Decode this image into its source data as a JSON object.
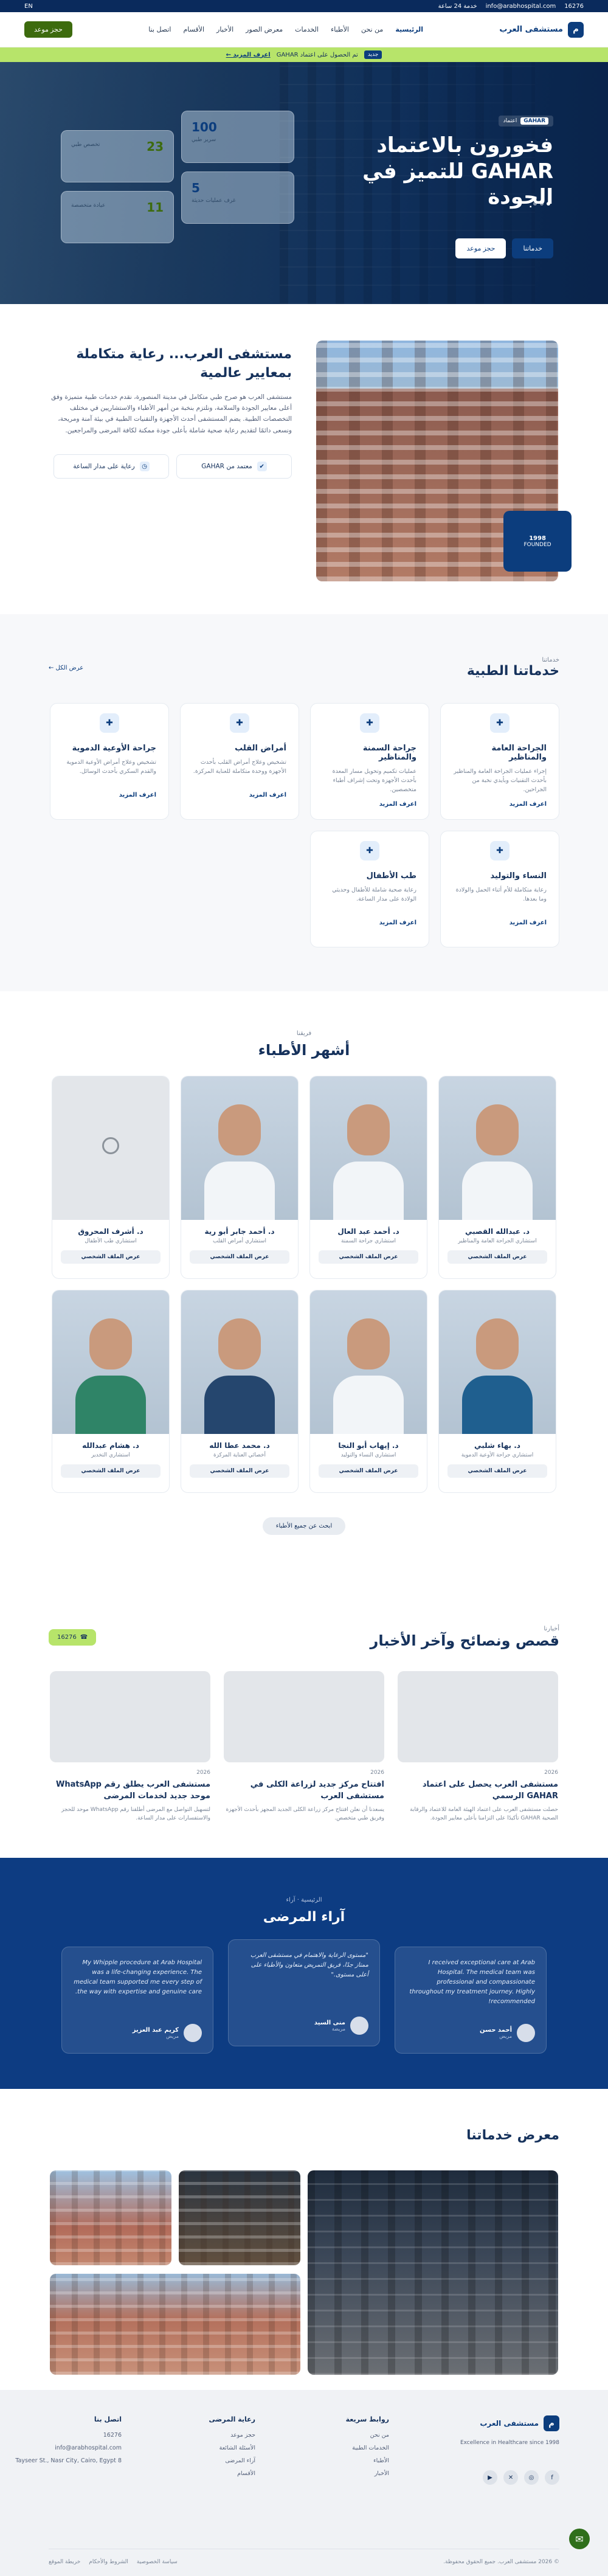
{
  "topbar": {
    "phone": "16276",
    "email": "info@arabhospital.com",
    "hours": "خدمة 24 ساعة",
    "lang": "EN"
  },
  "header": {
    "logo": "م",
    "brand": "مستشفى العرب",
    "nav": [
      "الرئيسية",
      "من نحن",
      "الأطباء",
      "الخدمات",
      "معرض الصور",
      "الأخبار",
      "الأقسام",
      "اتصل بنا"
    ],
    "book": "حجز موعد"
  },
  "announce": {
    "tag": "جديد",
    "text": "تم الحصول على اعتماد GAHAR",
    "link": "اعرف المزيد ←"
  },
  "hero": {
    "badge_tag": "GAHAR",
    "badge_text": "اعتماد",
    "title": "فخورون بالاعتماد GAHAR للتميز في الجودة",
    "primary": "خدماتنا",
    "secondary": "حجز موعد",
    "stats": [
      {
        "value": "100",
        "label": "سرير طبي",
        "green": false
      },
      {
        "value": "23",
        "label": "تخصص طبي",
        "green": true
      },
      {
        "value": "5",
        "label": "غرف عمليات حديثة",
        "green": false
      },
      {
        "value": "11",
        "label": "عيادة متخصصة",
        "green": true
      }
    ]
  },
  "about": {
    "tag_title": "1998",
    "tag_sub": "FOUNDED",
    "title": "مستشفى العرب... رعاية متكاملة بمعايير عالمية",
    "body": "مستشفى العرب هو صرح طبي متكامل في مدينة المنصورة، نقدم خدمات طبية متميزة وفق أعلى معايير الجودة والسلامة، ونلتزم بنخبة من أمهر الأطباء والاستشاريين في مختلف التخصصات الطبية. يضم المستشفى أحدث الأجهزة والتقنيات الطبية في بيئة آمنة ومريحة، ونسعى دائمًا لتقديم رعاية صحية شاملة بأعلى جودة ممكنة لكافة المرضى والمراجعين.",
    "pill1": "معتمد من GAHAR",
    "pill2": "رعاية على مدار الساعة"
  },
  "services": {
    "sub": "خدماتنا",
    "title": "خدماتنا الطبية",
    "link": "عرض الكل ←",
    "more": "اعرف المزيد",
    "items": [
      {
        "title": "الجراحة العامة والمناظير",
        "desc": "إجراء عمليات الجراحة العامة والمناظير بأحدث التقنيات وبأيدي نخبة من الجراحين."
      },
      {
        "title": "جراحة السمنة والمناظير",
        "desc": "عمليات تكميم وتحويل مسار المعدة بأحدث الأجهزة وتحت إشراف أطباء متخصصين."
      },
      {
        "title": "أمراض القلب",
        "desc": "تشخيص وعلاج أمراض القلب بأحدث الأجهزة ووحدة متكاملة للعناية المركزة."
      },
      {
        "title": "جراحة الأوعية الدموية",
        "desc": "تشخيص وعلاج أمراض الأوعية الدموية والقدم السكري بأحدث الوسائل."
      },
      {
        "title": "النساء والتوليد",
        "desc": "رعاية متكاملة للأم أثناء الحمل والولادة وما بعدها."
      },
      {
        "title": "طب الأطفال",
        "desc": "رعاية صحية شاملة للأطفال وحديثي الولادة على مدار الساعة."
      }
    ]
  },
  "doctors": {
    "kicker": "فريقنا",
    "title": "أشهر الأطباء",
    "profile": "عرض الملف الشخصي",
    "all": "ابحث عن جميع الأطباء",
    "items": [
      {
        "name": "د. عبدالله القصبي",
        "spec": "استشاري الجراحة العامة والمناظير",
        "style": "coat"
      },
      {
        "name": "د. أحمد عبد العال",
        "spec": "استشاري جراحة السمنة",
        "style": "coat"
      },
      {
        "name": "د. أحمد جابر أبو رية",
        "spec": "استشاري أمراض القلب",
        "style": "coat"
      },
      {
        "name": "د. أشرف المحروق",
        "spec": "استشاري طب الأطفال",
        "style": "empty"
      },
      {
        "name": "د. بهاء شلبي",
        "spec": "استشاري جراحة الأوعية الدموية",
        "style": "scrubs"
      },
      {
        "name": "د. إيهاب أبو النجا",
        "spec": "استشاري النساء والتوليد",
        "style": "coat"
      },
      {
        "name": "د. محمد عطا الله",
        "spec": "أخصائي العناية المركزة",
        "style": "navy"
      },
      {
        "name": "د. هشام عبدالله",
        "spec": "استشاري التخدير",
        "style": "green"
      }
    ]
  },
  "news": {
    "sub": "أخبارنا",
    "title": "قصص ونصائح وآخر الأخبار",
    "chip": "16276",
    "items": [
      {
        "date": "2026",
        "title": "مستشفى العرب يحصل على اعتماد GAHAR الرسمي",
        "excerpt": "حصلت مستشفى العرب على اعتماد الهيئة العامة للاعتماد والرقابة الصحية GAHAR تأكيدًا على التزامنا بأعلى معايير الجودة."
      },
      {
        "date": "2026",
        "title": "افتتاح مركز جديد لزراعة الكلى في مستشفى العرب",
        "excerpt": "يسعدنا أن نعلن افتتاح مركز زراعة الكلى الجديد المجهز بأحدث الأجهزة وفريق طبي متخصص."
      },
      {
        "date": "2026",
        "title": "مستشفى العرب يطلق رقم WhatsApp موحد جديد لخدمات المرضى",
        "excerpt": "لتسهيل التواصل مع المرضى أطلقنا رقم WhatsApp موحد للحجز والاستفسارات على مدار الساعة."
      }
    ]
  },
  "testimonials": {
    "crumb": "الرئيسية · آراء",
    "title": "آراء المرضى",
    "items": [
      {
        "quote": "I received exceptional care at Arab Hospital. The medical team was professional and compassionate throughout my treatment journey. Highly recommended!",
        "name": "أحمد حسن",
        "role": "مريض"
      },
      {
        "quote": "\"مستوى الرعاية والاهتمام في مستشفى العرب ممتاز جدًا، فريق التمريض متعاون والأطباء على أعلى مستوى.\"",
        "name": "منى السيد",
        "role": "مريضة"
      },
      {
        "quote": "My Whipple procedure at Arab Hospital was a life-changing experience. The medical team supported me every step of the way with expertise and genuine care.",
        "name": "كريم عبد العزيز",
        "role": "مريض"
      }
    ]
  },
  "gallery": {
    "title": "معرض خدماتنا"
  },
  "footer": {
    "brand": "مستشفى العرب",
    "desc": "Excellence in Healthcare since 1998",
    "col1_title": "روابط سريعة",
    "col1": [
      "من نحن",
      "الخدمات الطبية",
      "الأطباء",
      "الأخبار"
    ],
    "col2_title": "رعاية المرضى",
    "col2": [
      "حجز موعد",
      "الأسئلة الشائعة",
      "آراء المرضى",
      "الأقسام"
    ],
    "col3_title": "اتصل بنا",
    "col3": [
      "16276",
      "info@arabhospital.com",
      "8 Tayseer St., Nasr City, Cairo, Egypt"
    ],
    "copyright": "© 2026 مستشفى العرب. جميع الحقوق محفوظة.",
    "links": [
      "سياسة الخصوصية",
      "الشروط والأحكام",
      "خريطة الموقع"
    ]
  }
}
